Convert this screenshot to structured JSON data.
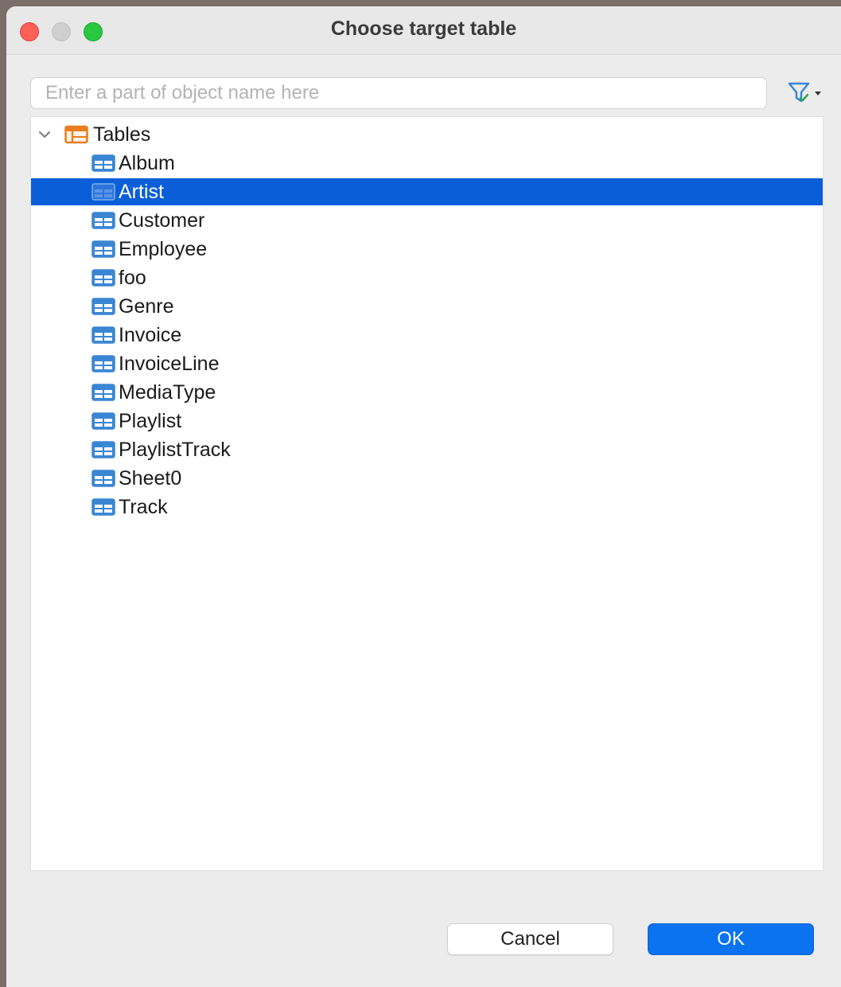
{
  "window": {
    "title": "Choose target table"
  },
  "search": {
    "placeholder": "Enter a part of object name here",
    "value": ""
  },
  "filter": {
    "icon": "filter-icon"
  },
  "tree": {
    "root": {
      "label": "Tables",
      "expanded": true,
      "icon": "tables-folder-icon"
    },
    "items": [
      {
        "label": "Album",
        "selected": false
      },
      {
        "label": "Artist",
        "selected": true
      },
      {
        "label": "Customer",
        "selected": false
      },
      {
        "label": "Employee",
        "selected": false
      },
      {
        "label": "foo",
        "selected": false
      },
      {
        "label": "Genre",
        "selected": false
      },
      {
        "label": "Invoice",
        "selected": false
      },
      {
        "label": "InvoiceLine",
        "selected": false
      },
      {
        "label": "MediaType",
        "selected": false
      },
      {
        "label": "Playlist",
        "selected": false
      },
      {
        "label": "PlaylistTrack",
        "selected": false
      },
      {
        "label": "Sheet0",
        "selected": false
      },
      {
        "label": "Track",
        "selected": false
      }
    ]
  },
  "buttons": {
    "cancel_label": "Cancel",
    "ok_label": "OK"
  },
  "colors": {
    "selection": "#0a5fd8",
    "primary_button": "#0b72f0",
    "table_icon": "#3a86d4",
    "folder_icon": "#e87d1e"
  }
}
